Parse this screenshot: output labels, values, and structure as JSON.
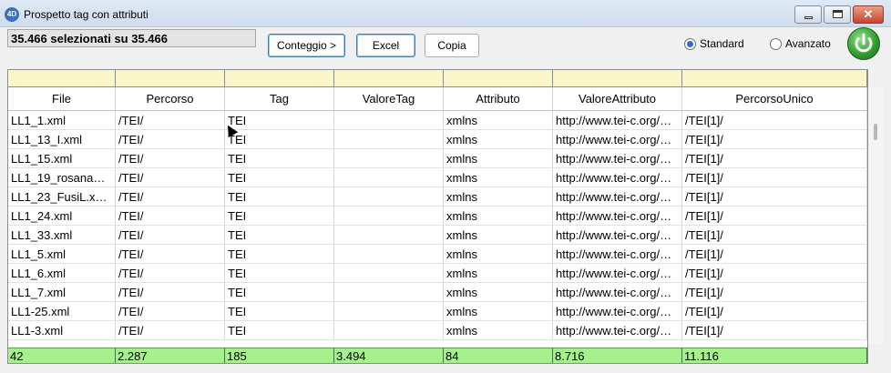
{
  "window": {
    "title": "Prospetto tag con attributi",
    "app_icon": "4D",
    "close_glyph": "✕"
  },
  "selection_info": "35.466 selezionati su 35.466",
  "buttons": {
    "conteggio": "Conteggio >",
    "excel": "Excel",
    "copia": "Copia"
  },
  "mode": {
    "standard": "Standard",
    "avanzato": "Avanzato",
    "selected": "Standard"
  },
  "columns": [
    "File",
    "Percorso",
    "Tag",
    "ValoreTag",
    "Attributo",
    "ValoreAttributo",
    "PercorsoUnico"
  ],
  "rows": [
    [
      "LL1_1.xml",
      "/TEI/",
      "TEI",
      "",
      "xmlns",
      "http://www.tei-c.org/…",
      "/TEI[1]/"
    ],
    [
      "LL1_13_I.xml",
      "/TEI/",
      "TEI",
      "",
      "xmlns",
      "http://www.tei-c.org/…",
      "/TEI[1]/"
    ],
    [
      "LL1_15.xml",
      "/TEI/",
      "TEI",
      "",
      "xmlns",
      "http://www.tei-c.org/…",
      "/TEI[1]/"
    ],
    [
      "LL1_19_rosana…",
      "/TEI/",
      "TEI",
      "",
      "xmlns",
      "http://www.tei-c.org/…",
      "/TEI[1]/"
    ],
    [
      "LL1_23_FusiL.x…",
      "/TEI/",
      "TEI",
      "",
      "xmlns",
      "http://www.tei-c.org/…",
      "/TEI[1]/"
    ],
    [
      "LL1_24.xml",
      "/TEI/",
      "TEI",
      "",
      "xmlns",
      "http://www.tei-c.org/…",
      "/TEI[1]/"
    ],
    [
      "LL1_33.xml",
      "/TEI/",
      "TEI",
      "",
      "xmlns",
      "http://www.tei-c.org/…",
      "/TEI[1]/"
    ],
    [
      "LL1_5.xml",
      "/TEI/",
      "TEI",
      "",
      "xmlns",
      "http://www.tei-c.org/…",
      "/TEI[1]/"
    ],
    [
      "LL1_6.xml",
      "/TEI/",
      "TEI",
      "",
      "xmlns",
      "http://www.tei-c.org/…",
      "/TEI[1]/"
    ],
    [
      "LL1_7.xml",
      "/TEI/",
      "TEI",
      "",
      "xmlns",
      "http://www.tei-c.org/…",
      "/TEI[1]/"
    ],
    [
      "LL1-25.xml",
      "/TEI/",
      "TEI",
      "",
      "xmlns",
      "http://www.tei-c.org/…",
      "/TEI[1]/"
    ],
    [
      "LL1-3.xml",
      "/TEI/",
      "TEI",
      "",
      "xmlns",
      "http://www.tei-c.org/…",
      "/TEI[1]/"
    ]
  ],
  "totals": [
    "42",
    "2.287",
    "185",
    "3.494",
    "84",
    "8.716",
    "11.116"
  ],
  "colors": {
    "filter_row": "#fbf6c8",
    "totals_row": "#a6f08e",
    "power_button": "#2d9a2a",
    "radio_accent": "#2f6fc6"
  },
  "icons": {
    "app": "4d-app-icon",
    "minimize": "minimize-icon",
    "maximize": "maximize-icon",
    "close": "close-icon",
    "power": "power-icon",
    "cursor": "mouse-pointer-icon"
  }
}
